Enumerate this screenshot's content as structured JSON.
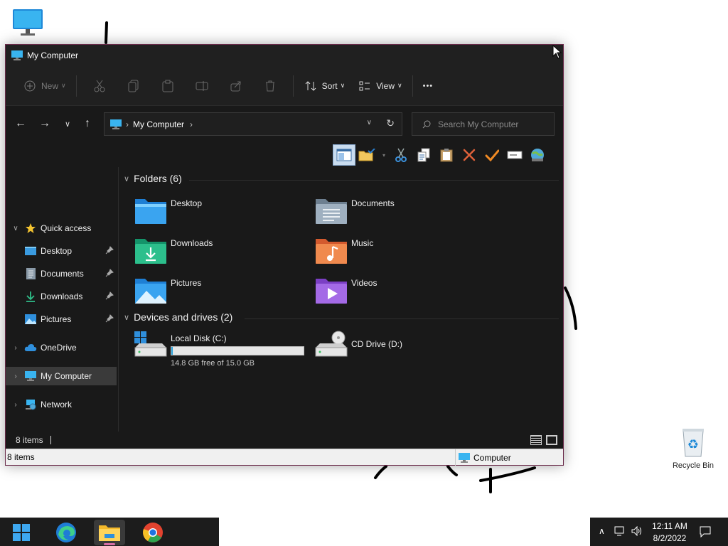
{
  "desktop": {
    "recycle_bin_label": "Recycle Bin"
  },
  "window": {
    "title": "My Computer",
    "command_bar": {
      "new_label": "New",
      "sort_label": "Sort",
      "view_label": "View",
      "more_label": "•••"
    },
    "address": {
      "crumb": "My Computer",
      "search_placeholder": "Search My Computer"
    },
    "nav_pane": {
      "quick_access": "Quick access",
      "desktop": "Desktop",
      "documents": "Documents",
      "downloads": "Downloads",
      "pictures": "Pictures",
      "onedrive": "OneDrive",
      "my_computer": "My Computer",
      "network": "Network"
    },
    "content": {
      "folders_header": "Folders (6)",
      "folders": [
        {
          "name": "Desktop",
          "icon": "desktop-folder-icon"
        },
        {
          "name": "Documents",
          "icon": "documents-folder-icon"
        },
        {
          "name": "Downloads",
          "icon": "downloads-folder-icon"
        },
        {
          "name": "Music",
          "icon": "music-folder-icon"
        },
        {
          "name": "Pictures",
          "icon": "pictures-folder-icon"
        },
        {
          "name": "Videos",
          "icon": "videos-folder-icon"
        }
      ],
      "drives_header": "Devices and drives (2)",
      "drives": [
        {
          "name": "Local Disk (C:)",
          "free_text": "14.8 GB free of 15.0 GB",
          "used_fraction": 0.013
        },
        {
          "name": "CD Drive (D:)"
        }
      ]
    },
    "status": {
      "items": "8 items",
      "classic_items": "8 items",
      "classic_zone": "Computer"
    }
  },
  "tray": {
    "time": "12:11 AM",
    "date": "8/2/2022"
  },
  "colors": {
    "accent": "#26a0da",
    "window_bg": "#191919",
    "folder_blue": "#2b8fe3"
  }
}
